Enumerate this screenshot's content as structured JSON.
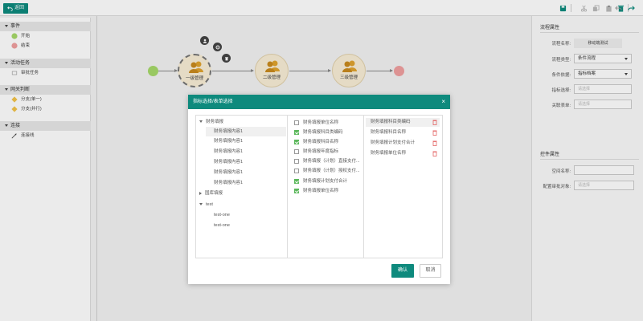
{
  "toolbar": {
    "back_label": "返回",
    "accent": "#0e8a7d"
  },
  "left_panel": {
    "sections": [
      {
        "title": "事件",
        "items": [
          {
            "label": "开始",
            "icon": "start-dot-icon"
          },
          {
            "label": "结束",
            "icon": "end-dot-icon"
          }
        ]
      },
      {
        "title": "活动任务",
        "items": [
          {
            "label": "审批任务",
            "icon": "task-icon"
          }
        ]
      },
      {
        "title": "网关判断",
        "items": [
          {
            "label": "分支(单一)",
            "icon": "gateway-icon"
          },
          {
            "label": "分支(并行)",
            "icon": "gateway-icon"
          }
        ]
      },
      {
        "title": "连接",
        "items": [
          {
            "label": "连接线",
            "icon": "connector-icon"
          }
        ]
      }
    ]
  },
  "flow": {
    "nodes": [
      {
        "label": "一级管理"
      },
      {
        "label": "二级管理"
      },
      {
        "label": "三级管理"
      }
    ],
    "start_color": "#a6d96a",
    "end_color": "#f0a0a0",
    "node_color": "#f9eed6"
  },
  "right_panel": {
    "process_title": "流程属性",
    "process_name_label": "流程名称:",
    "process_name_value": "移动端测试",
    "process_type_label": "流程类型:",
    "process_type_value": "条件流程",
    "condition_label": "条件依据:",
    "condition_value": "指标档案",
    "indicator_label": "指标选择:",
    "indicator_placeholder": "请选择",
    "form_label": "关联表单:",
    "form_placeholder": "请选择",
    "widget_title": "控件属性",
    "node_name_label": "空间名称:",
    "node_name_value": "",
    "approver_label": "配置审批对象:",
    "approver_placeholder": "请选择"
  },
  "modal": {
    "title": "指标选择/表单选择",
    "tree": [
      {
        "label": "财务填报",
        "level": 0,
        "caret": "down"
      },
      {
        "label": "财务填报内容1",
        "level": 1,
        "selected": true
      },
      {
        "label": "财务填报内容1",
        "level": 1
      },
      {
        "label": "财务填报内容1",
        "level": 1
      },
      {
        "label": "财务填报内容1",
        "level": 1
      },
      {
        "label": "财务填报内容1",
        "level": 1
      },
      {
        "label": "财务填报内容1",
        "level": 1
      },
      {
        "label": "国库填报",
        "level": 0,
        "caret": "right"
      },
      {
        "label": "test",
        "level": 0,
        "caret": "down"
      },
      {
        "label": "test-one",
        "level": 1
      },
      {
        "label": "test-one",
        "level": 1
      }
    ],
    "checklist": [
      {
        "label": "财务填报单位名称",
        "checked": false
      },
      {
        "label": "财务填报科目类编码",
        "checked": true
      },
      {
        "label": "财务填报科目名称",
        "checked": true
      },
      {
        "label": "财务填报年度指标",
        "checked": false
      },
      {
        "label": "财务填报（计划）直接支付...",
        "checked": false
      },
      {
        "label": "财务填报（计划）授权支付...",
        "checked": false
      },
      {
        "label": "财务填报计划支付合计",
        "checked": true
      },
      {
        "label": "财务填报单位名称",
        "checked": true
      }
    ],
    "selected": [
      {
        "label": "财务填报科目类编码"
      },
      {
        "label": "财务填报科目名称"
      },
      {
        "label": "财务填报计划支付合计"
      },
      {
        "label": "财务填报单位名称"
      }
    ],
    "ok_label": "确认",
    "cancel_label": "取消"
  }
}
